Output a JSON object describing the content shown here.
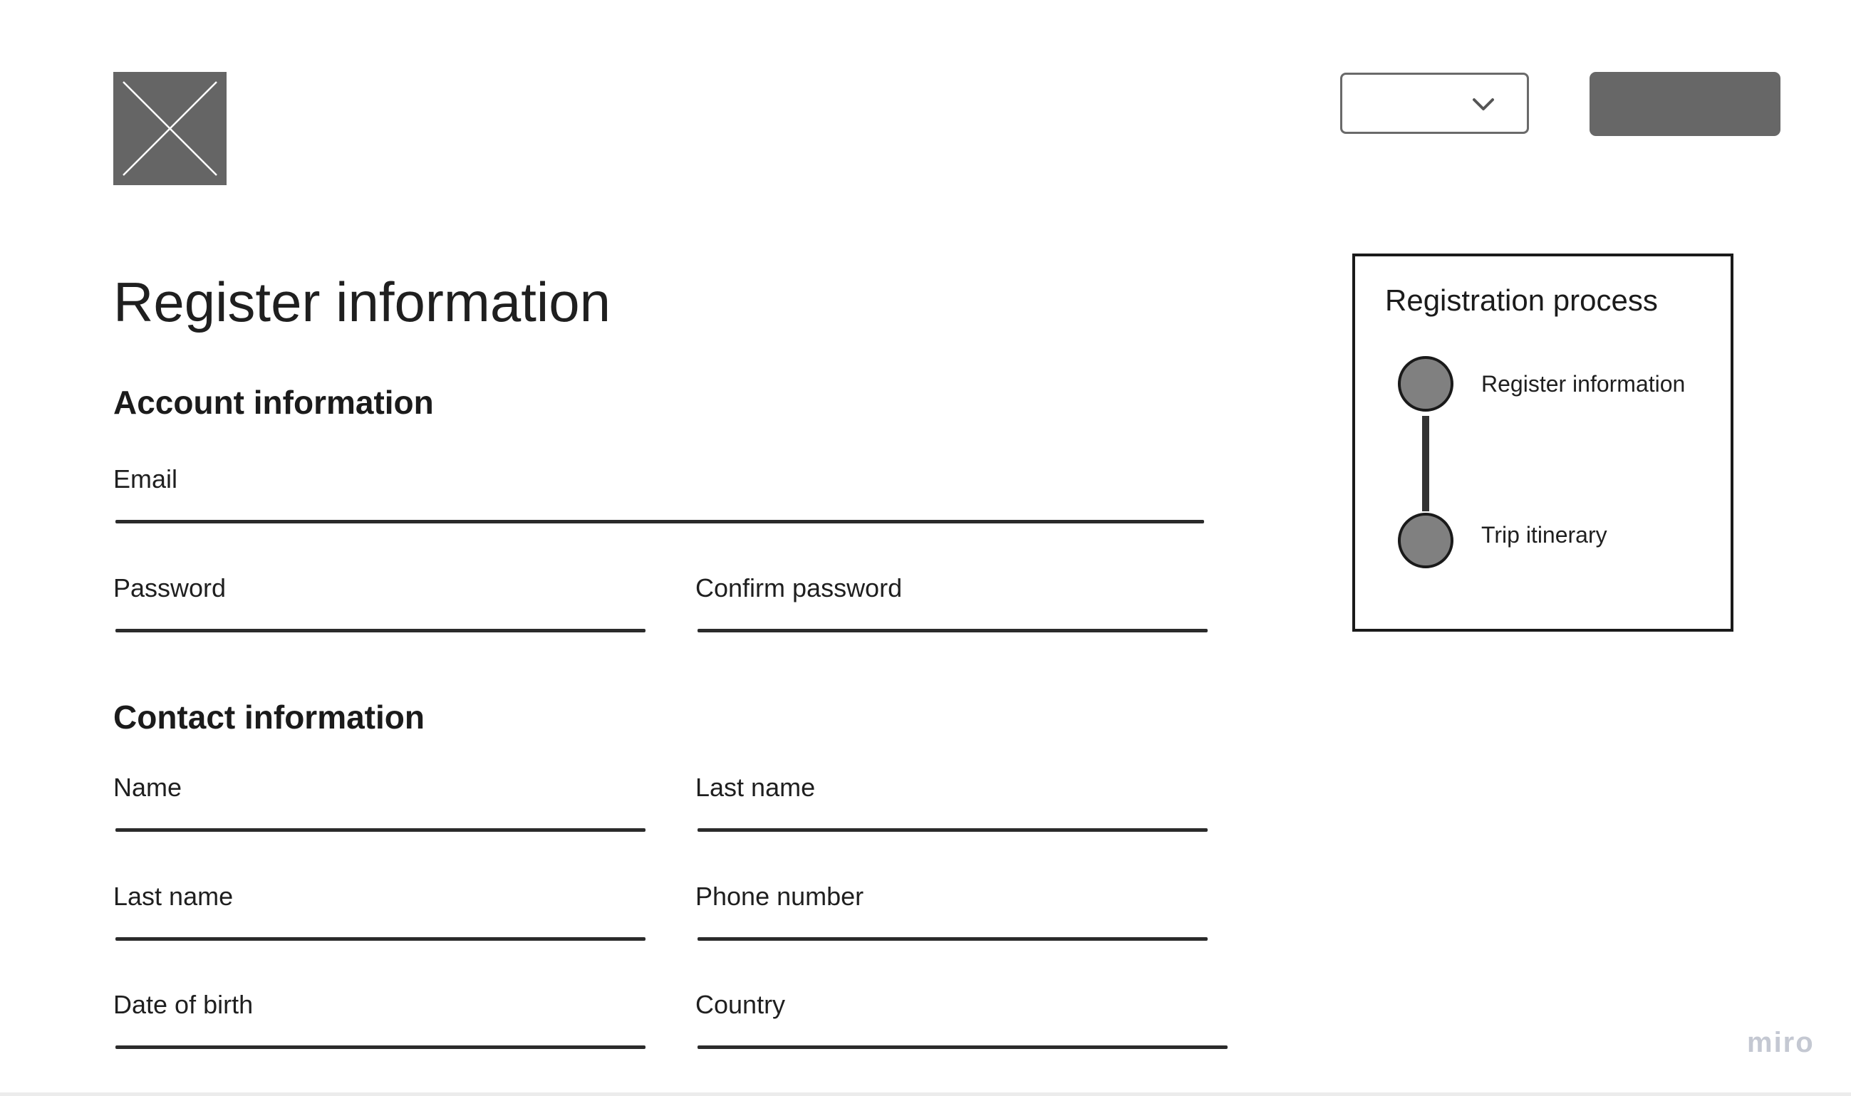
{
  "header": {
    "logo_icon": "image-placeholder-icon",
    "dropdown": {
      "selected_value": "",
      "icon": "chevron-down-icon"
    },
    "button_label": ""
  },
  "page": {
    "title": "Register information"
  },
  "account_section": {
    "heading": "Account information",
    "fields": {
      "email": {
        "label": "Email",
        "value": ""
      },
      "password": {
        "label": "Password",
        "value": ""
      },
      "confirm_password": {
        "label": "Confirm password",
        "value": ""
      }
    }
  },
  "contact_section": {
    "heading": "Contact information",
    "fields": {
      "name": {
        "label": "Name",
        "value": ""
      },
      "last_name": {
        "label": "Last name",
        "value": ""
      },
      "last_name_2": {
        "label": "Last name",
        "value": ""
      },
      "phone_number": {
        "label": "Phone number",
        "value": ""
      },
      "date_of_birth": {
        "label": "Date of birth",
        "value": ""
      },
      "country": {
        "label": "Country",
        "value": ""
      }
    }
  },
  "registration_process": {
    "title": "Registration process",
    "steps": [
      {
        "label": "Register information"
      },
      {
        "label": "Trip itinerary"
      }
    ]
  },
  "watermark": "miro",
  "colors": {
    "placeholder_fill": "#656565",
    "button_fill": "#676767",
    "step_dot_fill": "#808080",
    "underline": "#2b2b2b",
    "watermark": "#c4c8d2"
  }
}
